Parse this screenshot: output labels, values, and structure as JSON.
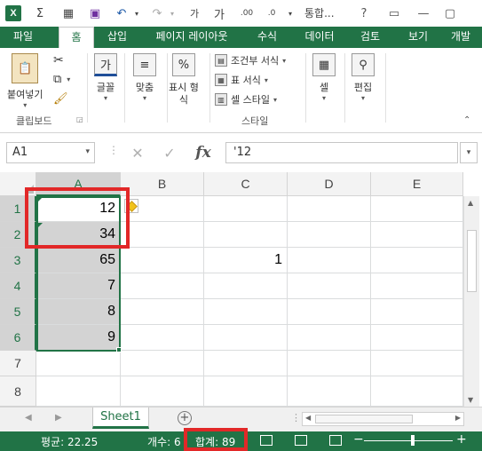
{
  "app": {
    "logo": "X",
    "title": "통합..."
  },
  "qat": {
    "save": "save-icon",
    "undo": "↶",
    "redo": "↷",
    "font_up": "가",
    "font_down": "가",
    "decimal": ".00",
    "more": "⋯"
  },
  "window": {
    "help": "?",
    "restore": "▭",
    "close": "✕"
  },
  "tabs": [
    "파일",
    "홈",
    "삽입",
    "페이지 레이아웃",
    "수식",
    "데이터",
    "검토",
    "보기",
    "개발"
  ],
  "active_tab": "홈",
  "ribbon": {
    "clipboard": {
      "paste": "붙여넣기",
      "cut_icon": "scissors-icon",
      "copy_icon": "copy-icon",
      "format_painter_icon": "brush-icon",
      "group": "클립보드"
    },
    "font": {
      "label": "글꼴",
      "icon": "가"
    },
    "align": {
      "label": "맞춤"
    },
    "number": {
      "label1": "표시 형",
      "label2": "식",
      "icon": "%"
    },
    "styles": {
      "conditional": "조건부 서식",
      "table": "표 서식",
      "cell_styles": "셀 스타일",
      "group": "스타일"
    },
    "cells": {
      "label": "셀"
    },
    "editing": {
      "label": "편집"
    }
  },
  "formula_bar": {
    "name_box": "A1",
    "formula": "'12",
    "fx": "fx"
  },
  "grid": {
    "columns": [
      "A",
      "B",
      "C",
      "D",
      "E"
    ],
    "rows": [
      "1",
      "2",
      "3",
      "4",
      "5",
      "6",
      "7",
      "8"
    ],
    "col_a": [
      "12",
      "34",
      "65",
      "7",
      "8",
      "9",
      "",
      ""
    ],
    "c3": "1"
  },
  "sheet": {
    "name": "Sheet1",
    "add": "+"
  },
  "status": {
    "average": "평균: 22.25",
    "count": "개수: 6",
    "sum": "합계: 89",
    "zoom_minus": "−",
    "zoom_plus": "+"
  },
  "colors": {
    "accent": "#217346",
    "highlight": "#e22828",
    "selection": "#d3d3d3"
  }
}
